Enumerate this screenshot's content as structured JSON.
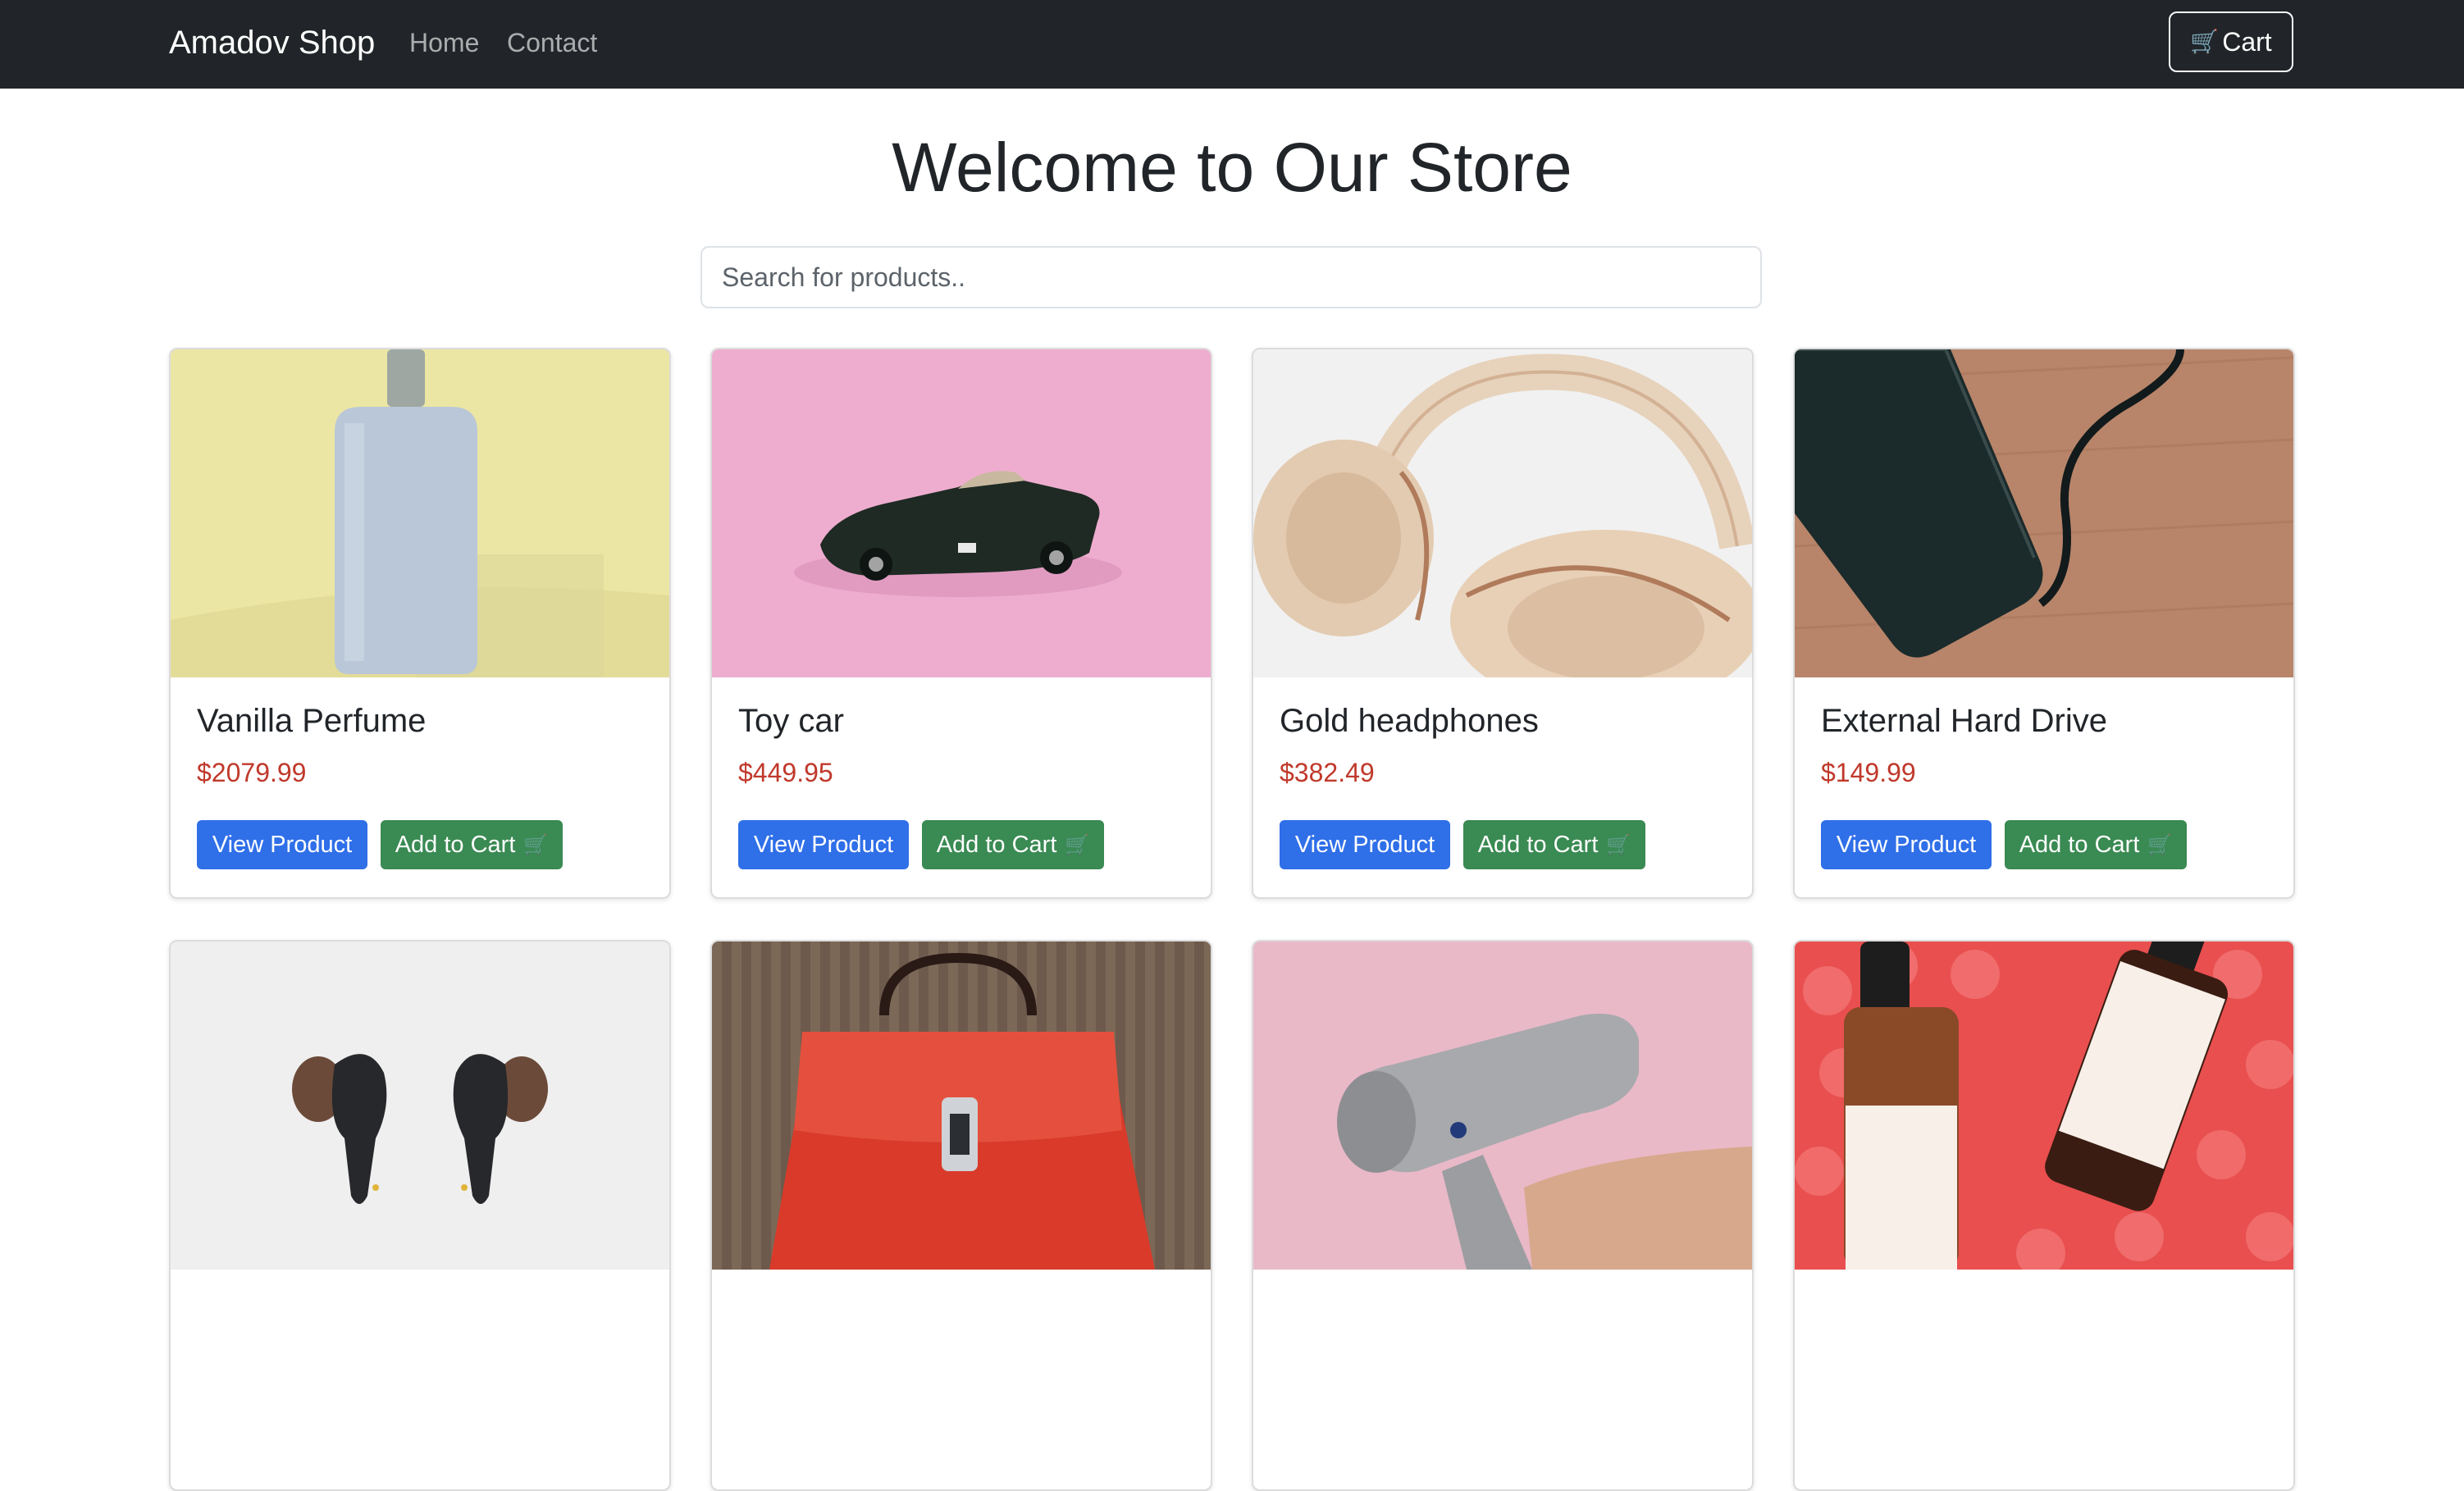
{
  "navbar": {
    "brand": "Amadov Shop",
    "links": [
      "Home",
      "Contact"
    ],
    "cart_label": "Cart",
    "cart_icon": "🛒"
  },
  "hero": {
    "title": "Welcome to Our Store",
    "search_placeholder": "Search for products.."
  },
  "products": [
    {
      "name": "Vanilla Perfume",
      "price": "$2079.99",
      "view_label": "View Product",
      "add_label": "Add to Cart",
      "add_icon": "🛒"
    },
    {
      "name": "Toy car",
      "price": "$449.95",
      "view_label": "View Product",
      "add_label": "Add to Cart",
      "add_icon": "🛒"
    },
    {
      "name": "Gold headphones",
      "price": "$382.49",
      "view_label": "View Product",
      "add_label": "Add to Cart",
      "add_icon": "🛒"
    },
    {
      "name": "External Hard Drive",
      "price": "$149.99",
      "view_label": "View Product",
      "add_label": "Add to Cart",
      "add_icon": "🛒"
    }
  ],
  "colors": {
    "navbar": "#212529",
    "primary": "#2f6fe8",
    "success": "#3a8a53",
    "price": "#c0392b"
  }
}
